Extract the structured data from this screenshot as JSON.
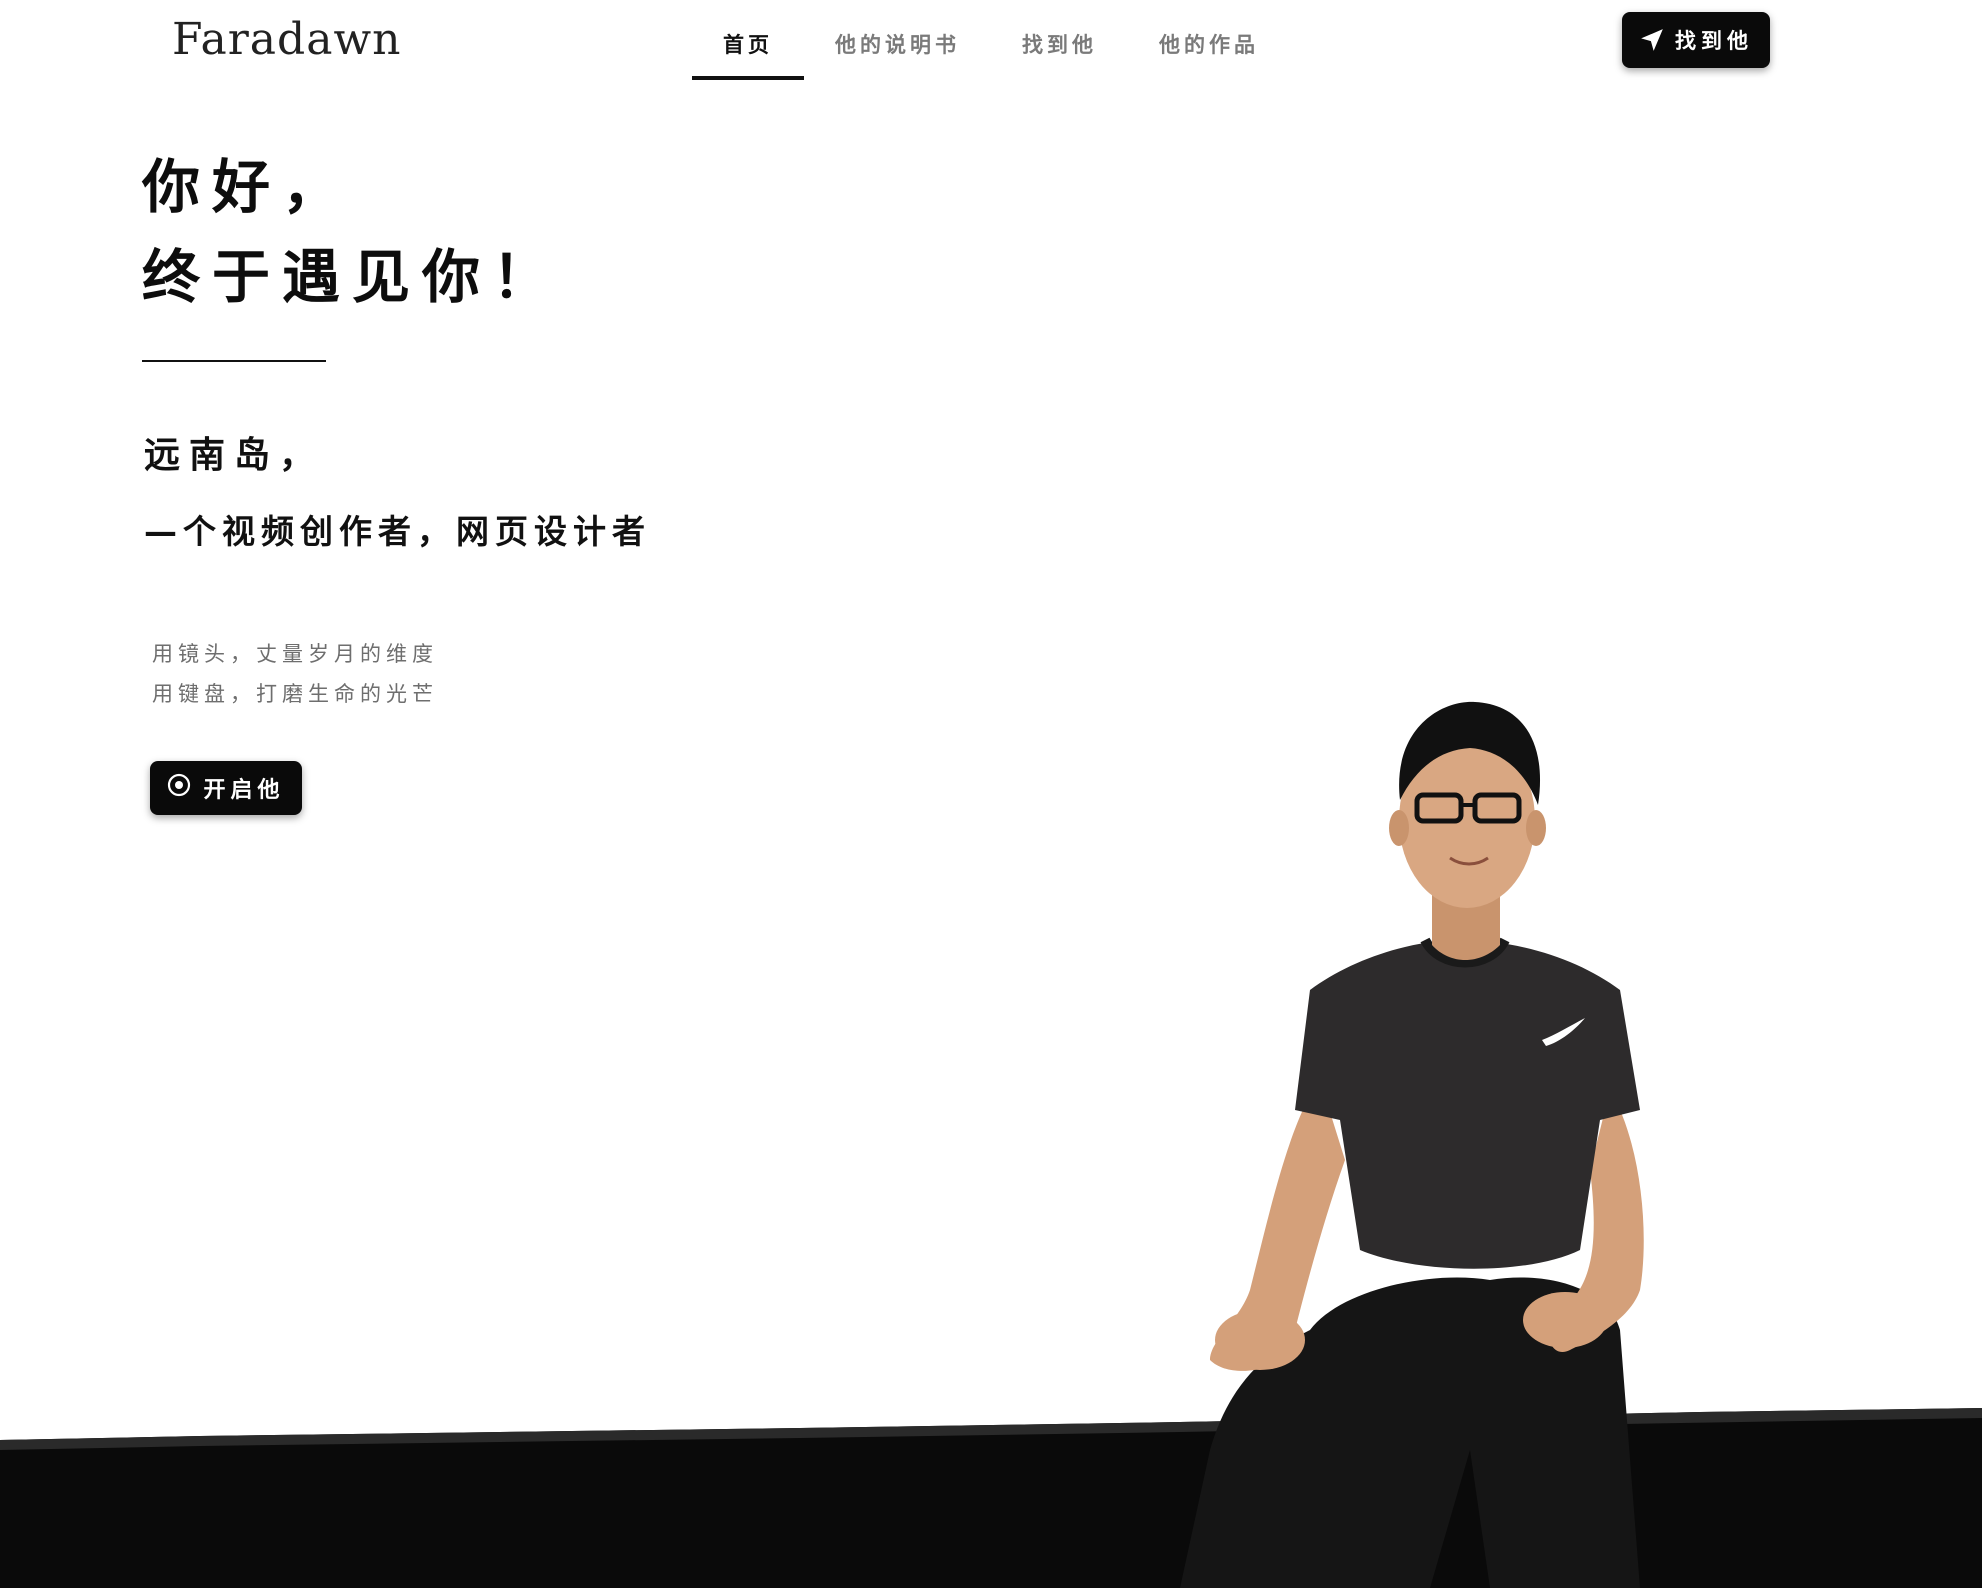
{
  "header": {
    "logo": "Faradawn",
    "nav": [
      {
        "label": "首页",
        "active": true
      },
      {
        "label": "他的说明书",
        "active": false
      },
      {
        "label": "找到他",
        "active": false
      },
      {
        "label": "他的作品",
        "active": false
      }
    ],
    "cta": {
      "label": "找到他",
      "icon": "paper-plane-icon"
    }
  },
  "hero": {
    "title_line1": "你好，",
    "title_line2": "终于遇见你！",
    "name": "远南岛，",
    "role": "—个视频创作者，网页设计者",
    "motto_line1": "用镜头，丈量岁月的维度",
    "motto_line2": "用键盘，打磨生命的光芒",
    "button": {
      "label": "开启他",
      "icon": "target-circle-icon"
    }
  },
  "colors": {
    "background": "#ffffff",
    "text_primary": "#111111",
    "text_muted": "#7a7a7a",
    "button_bg": "#0a0a0a",
    "button_text": "#ffffff",
    "ground": "#0a0a0a"
  }
}
